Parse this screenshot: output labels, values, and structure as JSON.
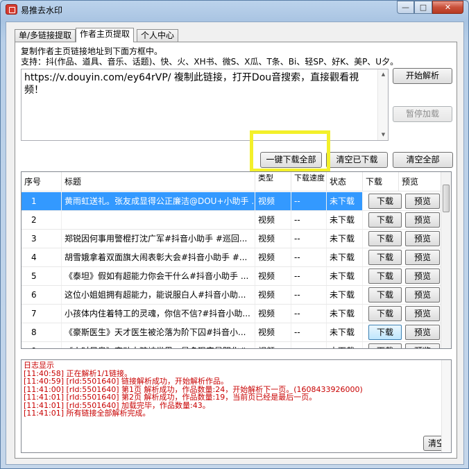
{
  "window": {
    "title": "易推去水印",
    "buttons": {
      "min": "—",
      "max": "□",
      "close": "✕"
    }
  },
  "tabs": [
    {
      "label": "单/多链接提取"
    },
    {
      "label": "作者主页提取"
    },
    {
      "label": "个人中心"
    }
  ],
  "panel": {
    "hint1": "复制作者主页链接地址到下面方框中。",
    "hint2": "支持：抖(作品、道具、音乐、话题)、快、火、XH书、微S、X瓜、T条、Bi、轻SP、好K、美P、U夕。",
    "url_value": "https://v.douyin.com/ey64rVP/ 複制此链接，打开Dou音搜索，直接觀看視频！",
    "btn_parse": "开始解析",
    "btn_pause": "暂停加载",
    "btn_download_all": "一键下载全部",
    "btn_clear_done": "清空已下载",
    "btn_clear_all": "清空全部"
  },
  "grid": {
    "headers": [
      "序号",
      "标题",
      "类型",
      "下载速度",
      "状态",
      "下载",
      "预览"
    ],
    "download_label": "下载",
    "preview_label": "预览",
    "rows": [
      {
        "no": "1",
        "title": "黄雨虹送礼。张友成显得公正廉洁@DOU+小助手 ...",
        "type": "视频",
        "speed": "--",
        "status": "未下载"
      },
      {
        "no": "2",
        "title": "",
        "type": "视频",
        "speed": "--",
        "status": "未下载"
      },
      {
        "no": "3",
        "title": "郑锐因何事用警棍打沈广军#抖音小助手 #巡回...",
        "type": "视频",
        "speed": "--",
        "status": "未下载"
      },
      {
        "no": "4",
        "title": "胡雪娥拿着双面旗大闹表彰大会#抖音小助手 #...",
        "type": "视频",
        "speed": "--",
        "status": "未下载"
      },
      {
        "no": "5",
        "title": "《泰坦》假如有超能力你会干什么#抖音小助手 ...",
        "type": "视频",
        "speed": "--",
        "status": "未下载"
      },
      {
        "no": "6",
        "title": "这位小姐姐拥有超能力，能说服白人#抖音小助...",
        "type": "视频",
        "speed": "--",
        "status": "未下载"
      },
      {
        "no": "7",
        "title": "小孩体内住着特工的灵魂，你信不信?#抖音小助...",
        "type": "视频",
        "speed": "--",
        "status": "未下载"
      },
      {
        "no": "8",
        "title": "《豪斯医生》天才医生被沦落为阶下囚#抖音小...",
        "type": "视频",
        "speed": "--",
        "status": "未下载"
      },
      {
        "no": "9",
        "title": "《小时尼奥》变动士孩被世界，是多现实是阴化#...",
        "type": "视频",
        "speed": "--",
        "status": "未下载"
      }
    ]
  },
  "log": {
    "title": "日志显示",
    "lines": [
      "[11:40:58] 正在解析1/1链接。",
      "[11:40:59] [rId:5501640] 链接解析成功，开始解析作品。",
      "[11:41:00] [rId:5501640] 第1页 解析成功，作品数量:24，开始解析下一页。(1608433926000)",
      "[11:41:01] [rId:5501640] 第2页 解析成功，作品数量:19，当前页已经是最后一页。",
      "[11:41:01] [rId:5501640] 加载完毕，作品数量:43。",
      "[11:41:01] 所有链接全部解析完成。"
    ],
    "btn_clear": "清空"
  },
  "colors": {
    "accent_selected": "#3399ff",
    "log_text": "#c80000",
    "highlight": "#f3f02a"
  }
}
